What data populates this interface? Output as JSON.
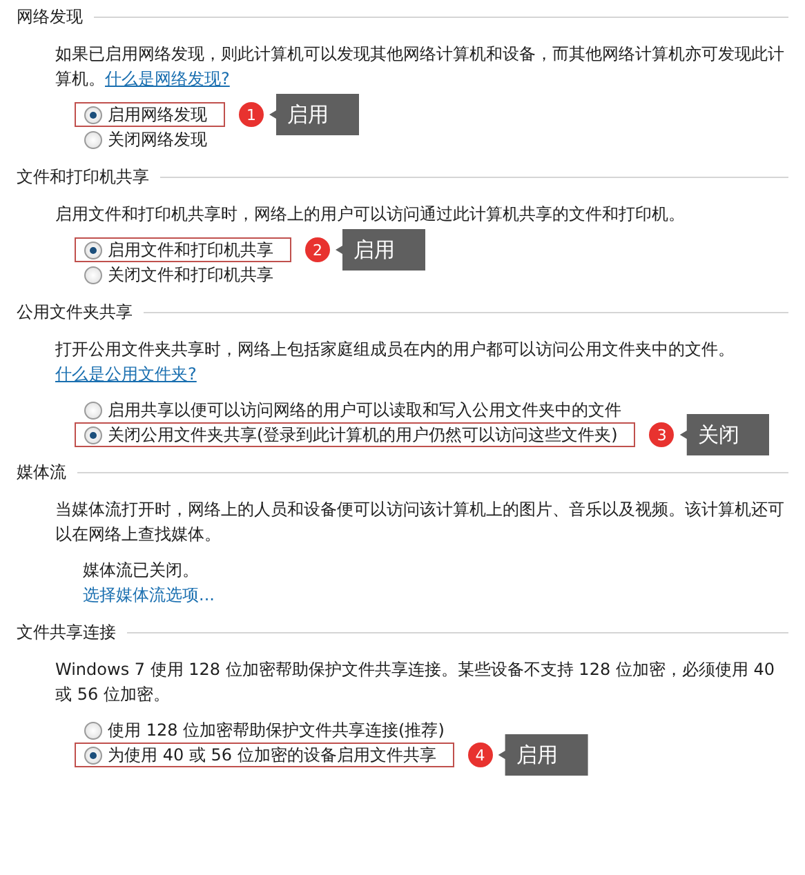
{
  "sections": [
    {
      "kind": "options",
      "title": "网络发现",
      "description": "如果已启用网络发现，则此计算机可以发现其他网络计算机和设备，而其他网络计算机亦可发现此计算机。",
      "link": "什么是网络发现?",
      "options": [
        {
          "label": "启用网络发现",
          "selected": true,
          "annotation": {
            "number": "1",
            "tag": "启用"
          }
        },
        {
          "label": "关闭网络发现",
          "selected": false
        }
      ]
    },
    {
      "kind": "options",
      "title": "文件和打印机共享",
      "description": "启用文件和打印机共享时，网络上的用户可以访问通过此计算机共享的文件和打印机。",
      "options": [
        {
          "label": "启用文件和打印机共享",
          "selected": true,
          "annotation": {
            "number": "2",
            "tag": "启用"
          }
        },
        {
          "label": "关闭文件和打印机共享",
          "selected": false
        }
      ]
    },
    {
      "kind": "options",
      "title": "公用文件夹共享",
      "description": "打开公用文件夹共享时，网络上包括家庭组成员在内的用户都可以访问公用文件夹中的文件。",
      "link": "什么是公用文件夹?",
      "options": [
        {
          "label": "启用共享以便可以访问网络的用户可以读取和写入公用文件夹中的文件",
          "selected": false
        },
        {
          "label": "关闭公用文件夹共享(登录到此计算机的用户仍然可以访问这些文件夹)",
          "selected": true,
          "annotation": {
            "number": "3",
            "tag": "关闭"
          }
        }
      ]
    },
    {
      "kind": "media",
      "title": "媒体流",
      "description": "当媒体流打开时，网络上的人员和设备便可以访问该计算机上的图片、音乐以及视频。该计算机还可以在网络上查找媒体。",
      "status": "媒体流已关闭。",
      "action": "选择媒体流选项..."
    },
    {
      "kind": "options",
      "title": "文件共享连接",
      "description": "Windows 7 使用 128 位加密帮助保护文件共享连接。某些设备不支持 128 位加密，必须使用 40 或 56 位加密。",
      "options": [
        {
          "label": "使用 128 位加密帮助保护文件共享连接(推荐)",
          "selected": false
        },
        {
          "label": "为使用 40 或 56 位加密的设备启用文件共享",
          "selected": true,
          "annotation": {
            "number": "4",
            "tag": "启用"
          }
        }
      ]
    }
  ]
}
